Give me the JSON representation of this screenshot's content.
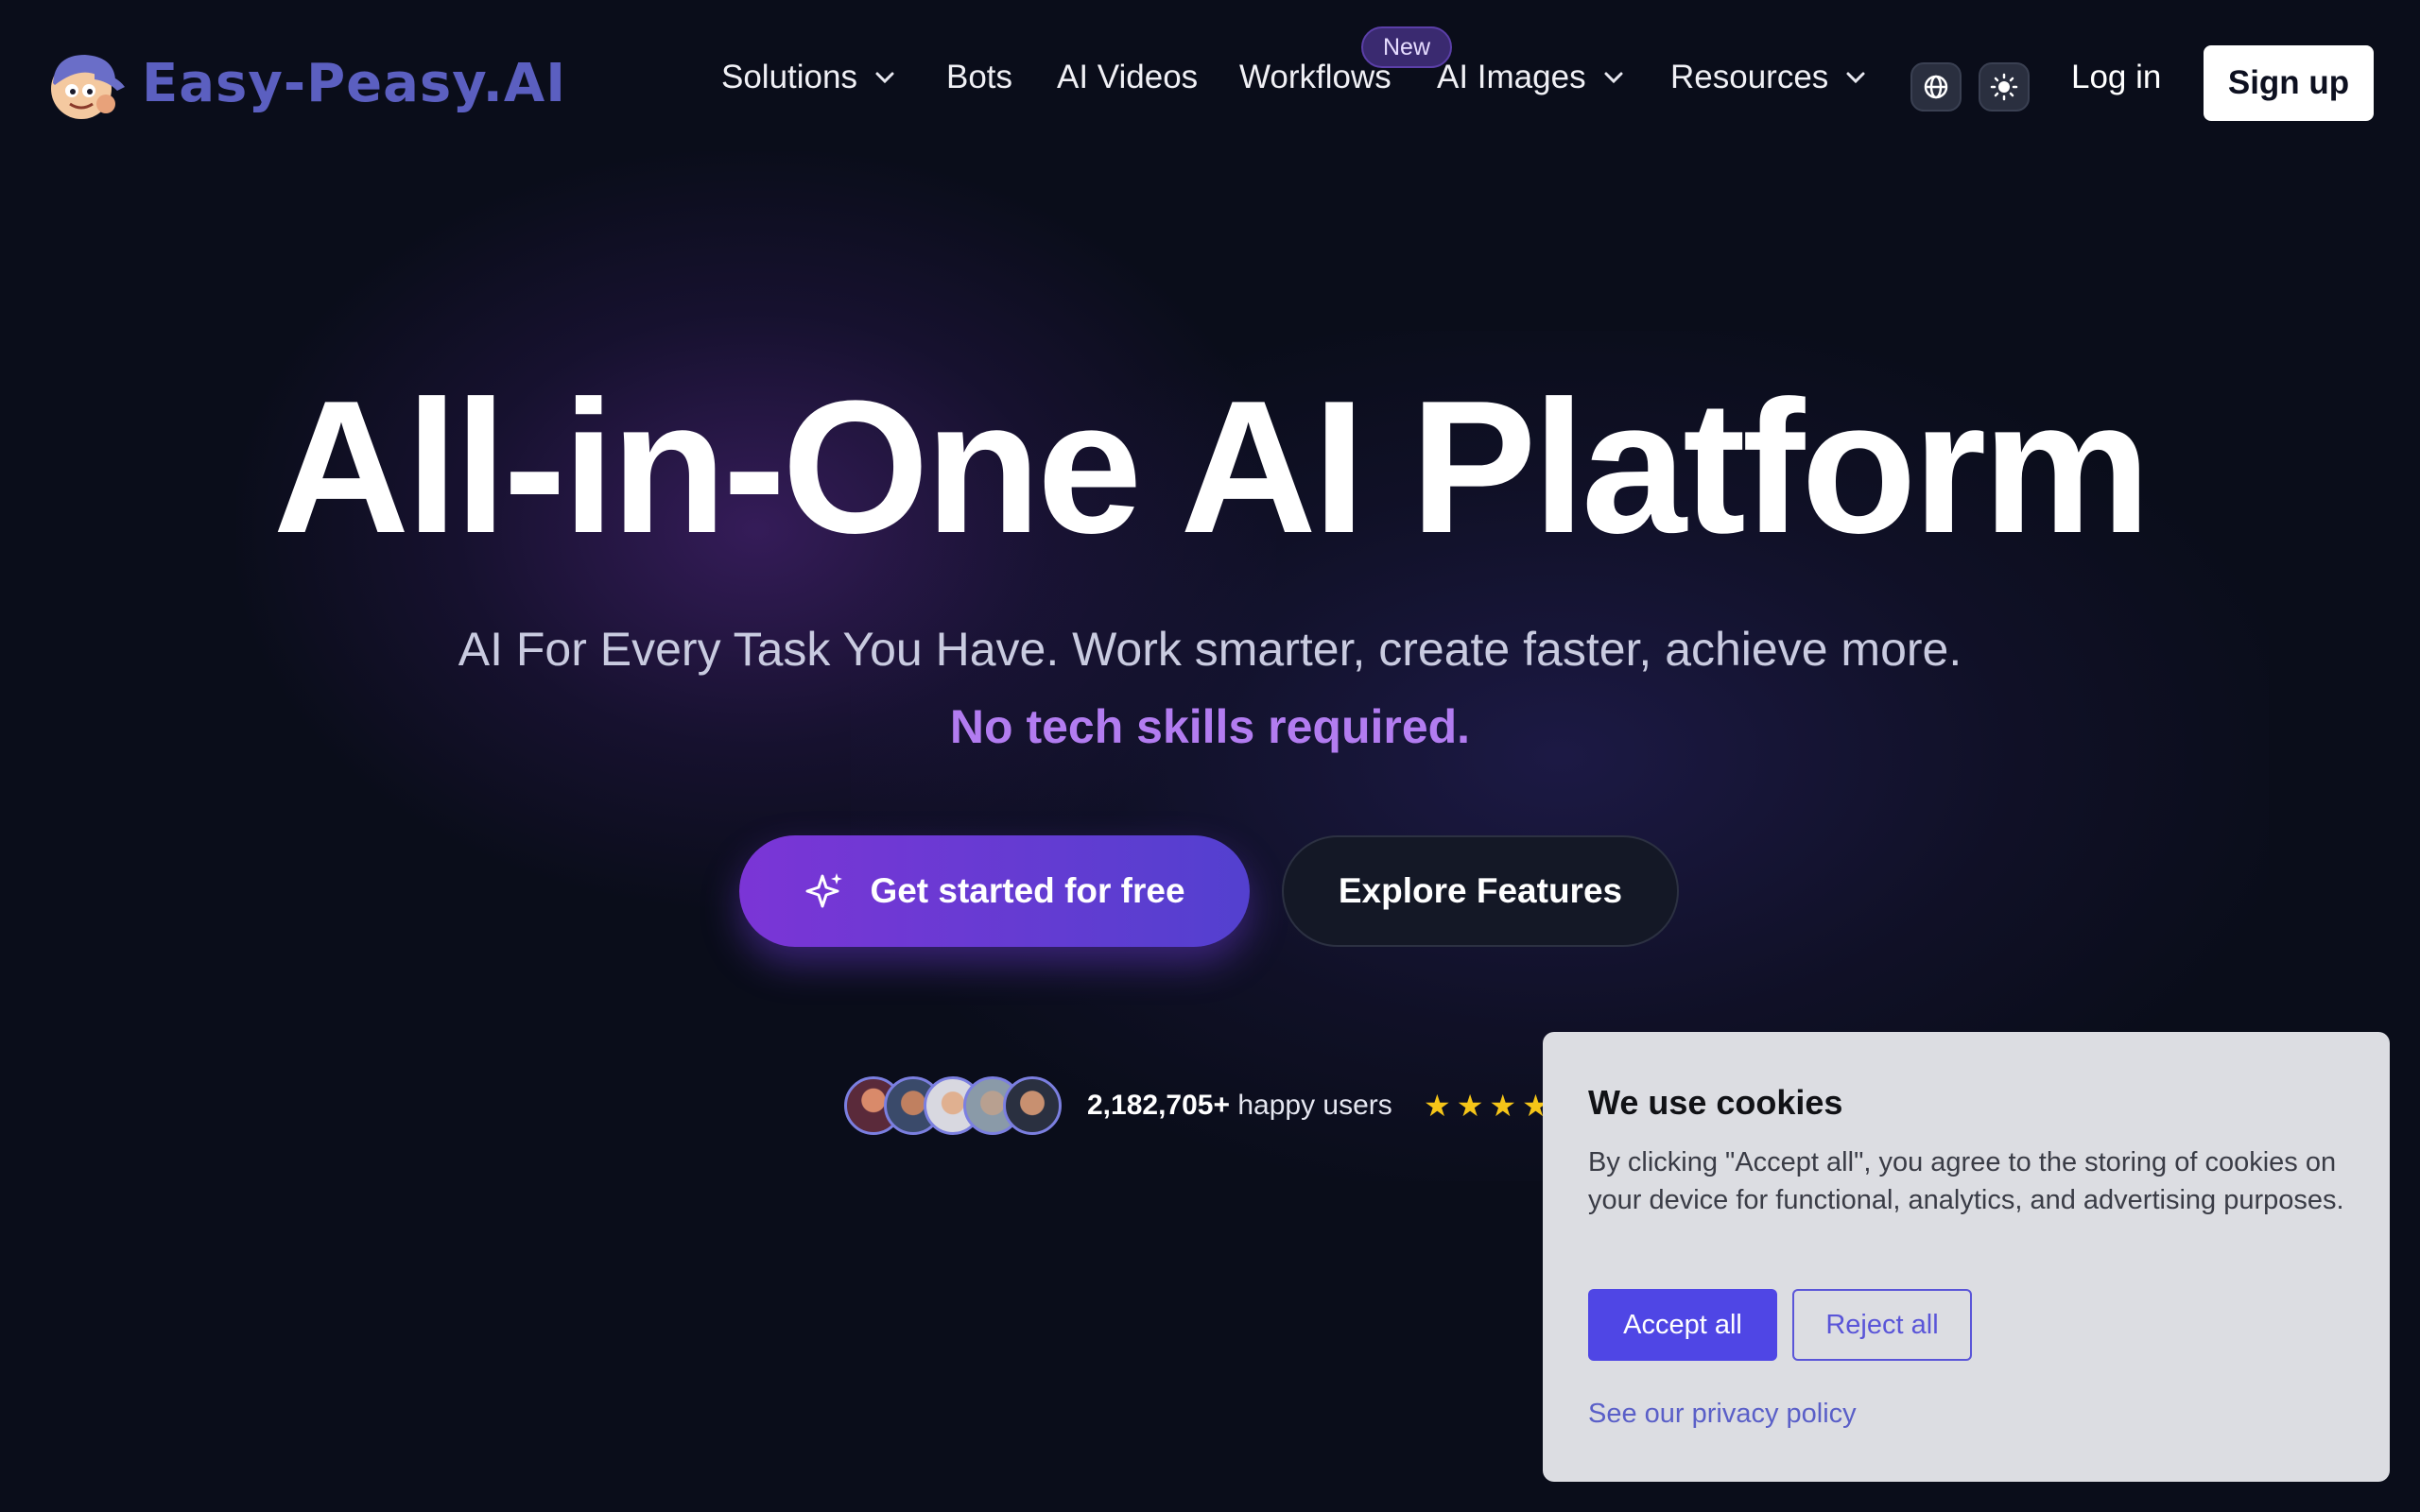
{
  "brand": {
    "name": "Easy-Peasy.AI",
    "logo_color": "#5b5fc0"
  },
  "nav": {
    "items": [
      {
        "label": "Solutions",
        "has_dropdown": true
      },
      {
        "label": "Bots",
        "has_dropdown": false
      },
      {
        "label": "AI Videos",
        "has_dropdown": false
      },
      {
        "label": "Workflows",
        "has_dropdown": false
      },
      {
        "label": "AI Images",
        "has_dropdown": true
      },
      {
        "label": "Resources",
        "has_dropdown": true
      }
    ],
    "new_badge": "New",
    "language_icon": "globe-icon",
    "theme_icon": "sun-icon",
    "login": "Log in",
    "signup": "Sign up"
  },
  "hero": {
    "title": "All-in-One AI Platform",
    "subtitle": "AI For Every Task You Have. Work smarter, create faster, achieve more.",
    "accent": "No tech skills required.",
    "accent_color": "#b27cf0",
    "cta_primary": "Get started for free",
    "cta_primary_icon": "sparkles-icon",
    "cta_secondary": "Explore Features"
  },
  "social_proof": {
    "user_count": "2,182,705+",
    "user_suffix": "happy users",
    "rating_stars": 4.5,
    "star_color": "#f5c518"
  },
  "cookie_banner": {
    "title": "We use cookies",
    "body": "By clicking \"Accept all\", you agree to the storing of cookies on your device for functional, analytics, and advertising purposes.",
    "accept": "Accept all",
    "reject": "Reject all",
    "privacy_link": "See our privacy policy",
    "accent_color": "#4f46e5"
  }
}
